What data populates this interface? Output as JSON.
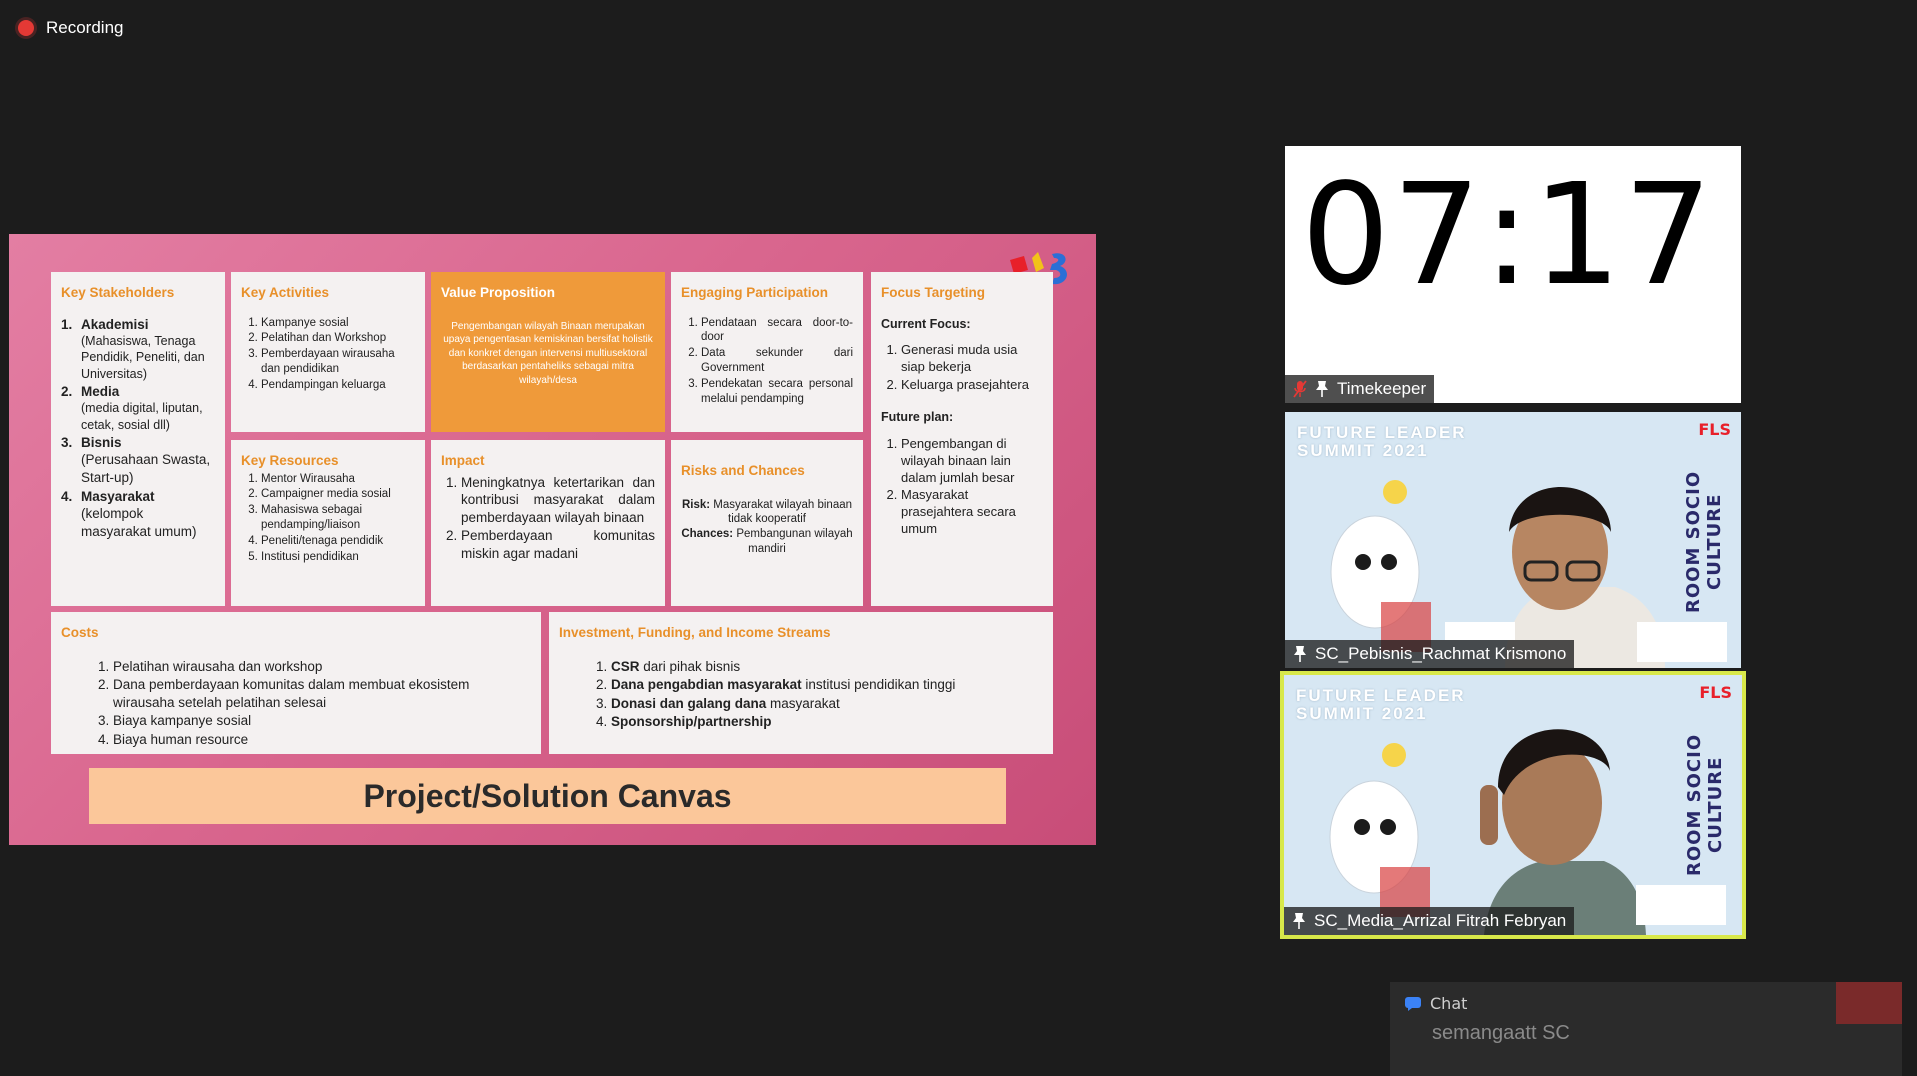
{
  "recording": {
    "label": "Recording"
  },
  "slide": {
    "key_stakeholders": {
      "title": "Key Stakeholders",
      "items": [
        {
          "n": "1.",
          "head": "Akademisi",
          "rest": "(Mahasiswa, Tenaga Pendidik, Peneliti, dan Universitas)"
        },
        {
          "n": "2.",
          "head": "Media",
          "rest": "(media digital, liputan, cetak, sosial dll)"
        },
        {
          "n": "3.",
          "head": "Bisnis",
          "rest": "(Perusahaan Swasta, Start-up)"
        },
        {
          "n": "4.",
          "head": "Masyarakat",
          "rest": "(kelompok masyarakat umum)"
        }
      ]
    },
    "key_activities": {
      "title": "Key Activities",
      "items": [
        "Kampanye sosial",
        "Pelatihan dan Workshop",
        "Pemberdayaan wirausaha dan pendidikan",
        "Pendampingan keluarga"
      ]
    },
    "value_proposition": {
      "title": "Value Proposition",
      "text": "Pengembangan wilayah Binaan merupakan upaya pengentasan kemiskinan bersifat holistik dan konkret dengan intervensi multiusektoral berdasarkan pentaheliks sebagai mitra wilayah/desa"
    },
    "engaging_participation": {
      "title": "Engaging Participation",
      "items": [
        "Pendataan secara door-to-door",
        "Data sekunder dari Government",
        "Pendekatan secara personal melalui pendamping"
      ]
    },
    "focus_targeting": {
      "title": "Focus Targeting",
      "current_label": "Current Focus:",
      "current_items": [
        "Generasi muda usia siap bekerja",
        "Keluarga prasejahtera"
      ],
      "future_label": "Future plan:",
      "future_items": [
        "Pengembangan di wilayah binaan lain dalam jumlah besar",
        "Masyarakat prasejahtera secara umum"
      ]
    },
    "key_resources": {
      "title": "Key Resources",
      "items": [
        "Mentor Wirausaha",
        "Campaigner media sosial",
        "Mahasiswa sebagai pendamping/liaison",
        "Peneliti/tenaga pendidik",
        "Institusi pendidikan"
      ]
    },
    "impact": {
      "title": "Impact",
      "items": [
        "Meningkatnya ketertarikan dan kontribusi masyarakat dalam pemberdayaan wilayah binaan",
        "Pemberdayaan komunitas miskin agar madani"
      ]
    },
    "risks": {
      "title": "Risks and Chances",
      "risk_label": "Risk:",
      "risk_text": "Masyarakat wilayah binaan tidak kooperatif",
      "chance_label": "Chances:",
      "chance_text": "Pembangunan wilayah mandiri"
    },
    "costs": {
      "title": "Costs",
      "items": [
        "Pelatihan wirausaha dan workshop",
        "Dana pemberdayaan komunitas dalam membuat ekosistem wirausaha setelah pelatihan selesai",
        "Biaya kampanye sosial",
        "Biaya human resource"
      ]
    },
    "investment": {
      "title": "Investment, Funding, and Income Streams",
      "items": [
        {
          "bold": "CSR",
          "rest": " dari pihak bisnis"
        },
        {
          "bold": "Dana pengabdian masyarakat",
          "rest": " institusi pendidikan tinggi"
        },
        {
          "bold": "Donasi dan galang dana",
          "rest": " masyarakat"
        },
        {
          "bold": "Sponsorship/partnership",
          "rest": ""
        }
      ]
    },
    "title_bar": "Project/Solution Canvas"
  },
  "participants": {
    "timer": {
      "time": "07:17",
      "name": "Timekeeper"
    },
    "cam1": {
      "name": "SC_Pebisnis_Rachmat Krismono"
    },
    "cam2": {
      "name": "SC_Media_Arrizal Fitrah Febryan"
    },
    "banner": {
      "line1": "FUTURE LEADER",
      "line2": "SUMMIT 2021",
      "logo": "FLS",
      "vertical": "ROOM SOCIO CULTURE"
    }
  },
  "chat": {
    "label": "Chat",
    "message": "semangaatt SC"
  },
  "colors": {
    "accent_orange": "#ef9a3a",
    "slide_pink": "#d9668e",
    "active_speaker": "#d8e84a",
    "record_red": "#e53935"
  }
}
